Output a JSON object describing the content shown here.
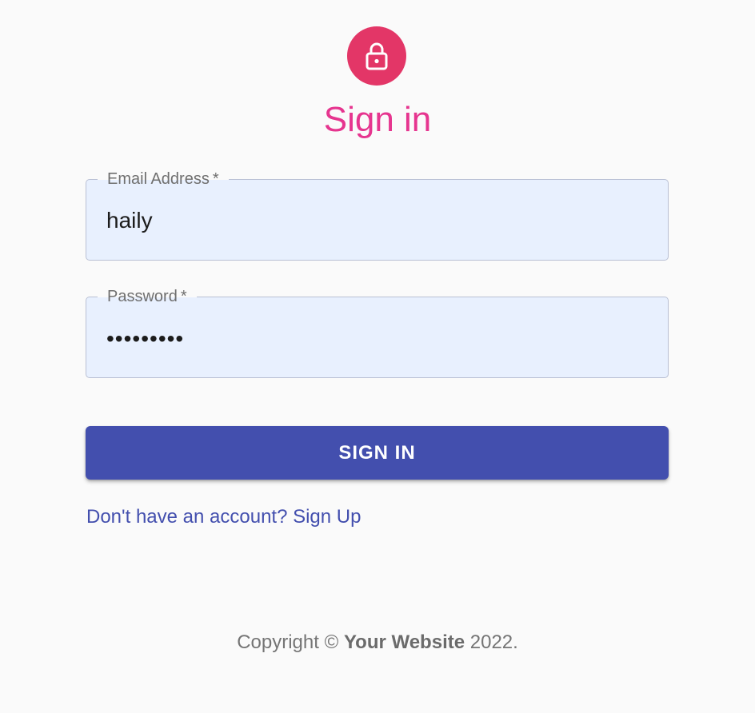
{
  "icon": {
    "name": "lock-icon",
    "background": "#e33667"
  },
  "heading": {
    "title": "Sign in"
  },
  "form": {
    "email": {
      "label": "Email Address",
      "required_mark": "*",
      "value": "haily"
    },
    "password": {
      "label": "Password",
      "required_mark": "*",
      "value": "•••••••••"
    },
    "submit_label": "SIGN IN",
    "signup_link": "Don't have an account? Sign Up"
  },
  "footer": {
    "prefix": "Copyright ©",
    "site": "Your Website",
    "year": "2022."
  },
  "colors": {
    "accent": "#434fae",
    "title": "#e6358f",
    "field_background": "#e8f0fe"
  }
}
